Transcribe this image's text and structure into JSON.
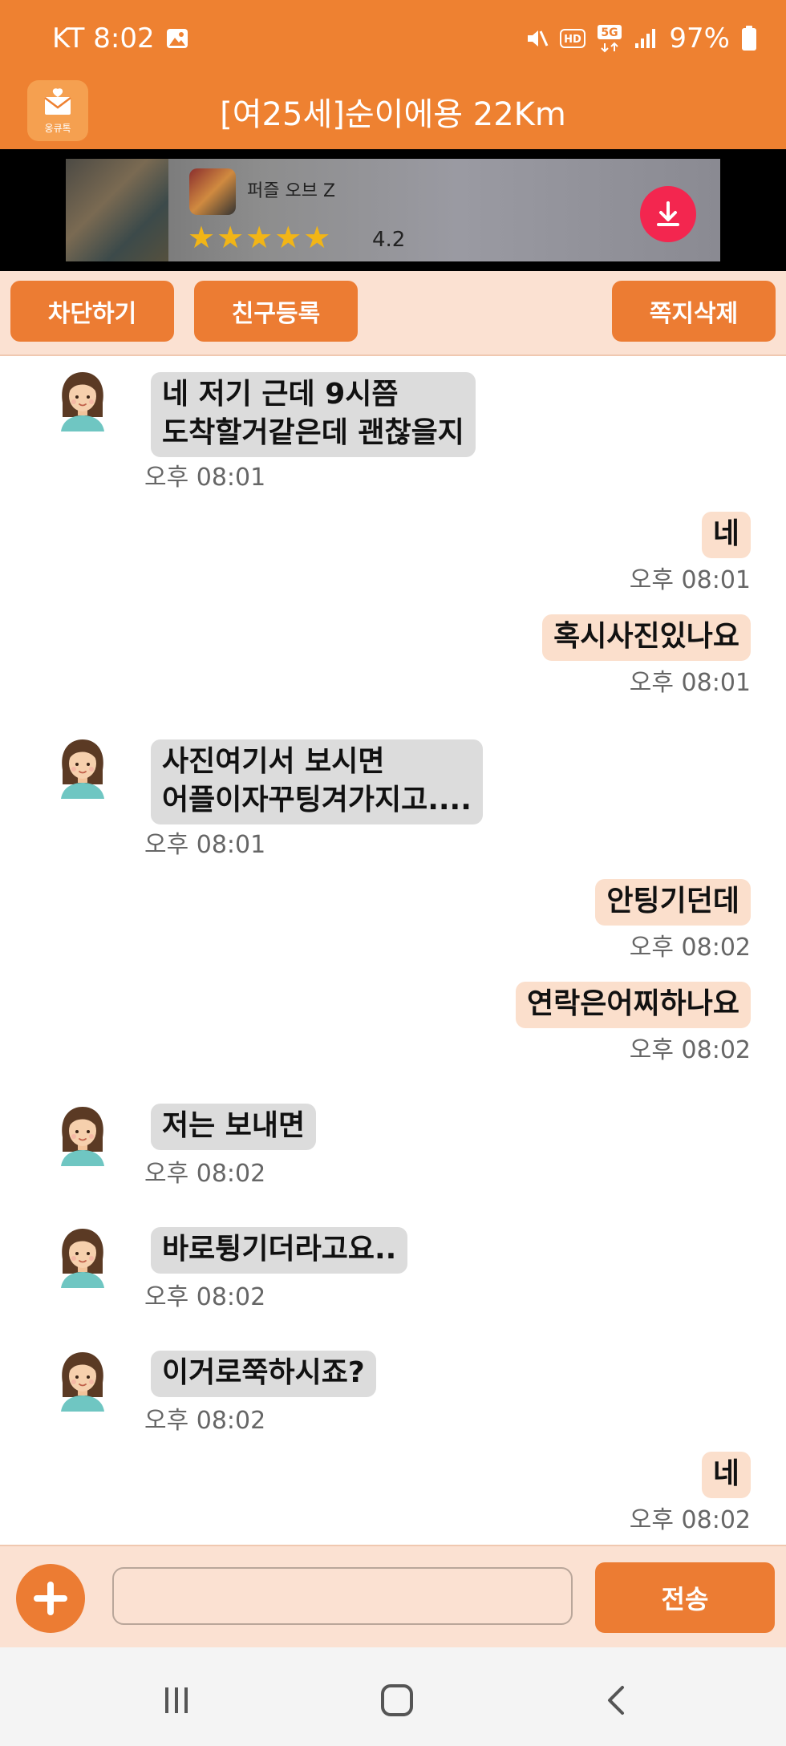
{
  "status_bar": {
    "carrier_time": "KT 8:02",
    "battery": "97%",
    "icons": [
      "image-icon",
      "mute-icon",
      "hd-icon",
      "5g-icon",
      "signal-icon",
      "battery-icon"
    ]
  },
  "header": {
    "logo_text": "옹큐톡",
    "title": "[여25세]순이에용 22Km"
  },
  "ad": {
    "app_name": "퍼즐 오브 Z",
    "stars": "★★★★★",
    "rating": "4.2",
    "icon": "download-icon"
  },
  "actions": {
    "block_label": "차단하기",
    "add_friend_label": "친구등록",
    "delete_label": "쪽지삭제"
  },
  "messages": [
    {
      "side": "left",
      "text": "네 저기 근데 9시쯤\n도착할거같은데 괜찮을지",
      "time": "오후 08:01"
    },
    {
      "side": "right",
      "text": "네",
      "time": "오후 08:01"
    },
    {
      "side": "right",
      "text": "혹시사진있나요",
      "time": "오후 08:01"
    },
    {
      "side": "left",
      "text": "사진여기서 보시면\n어플이자꾸팅겨가지고....",
      "time": "오후 08:01"
    },
    {
      "side": "right",
      "text": "안팅기던데",
      "time": "오후 08:02"
    },
    {
      "side": "right",
      "text": "연락은어찌하나요",
      "time": "오후 08:02"
    },
    {
      "side": "left",
      "text": "저는 보내면",
      "time": "오후 08:02"
    },
    {
      "side": "left",
      "text": "바로튕기더라고요..",
      "time": "오후 08:02"
    },
    {
      "side": "left",
      "text": "이거로쭉하시죠?",
      "time": "오후 08:02"
    },
    {
      "side": "right",
      "text": "네",
      "time": "오후 08:02"
    }
  ],
  "composer": {
    "placeholder": "",
    "send_label": "전송"
  },
  "colors": {
    "accent": "#ec7c33",
    "header": "#ee8131",
    "panel": "#fbe1d2",
    "left_bubble": "#dcdcdc",
    "right_bubble": "#fbdfcc"
  }
}
